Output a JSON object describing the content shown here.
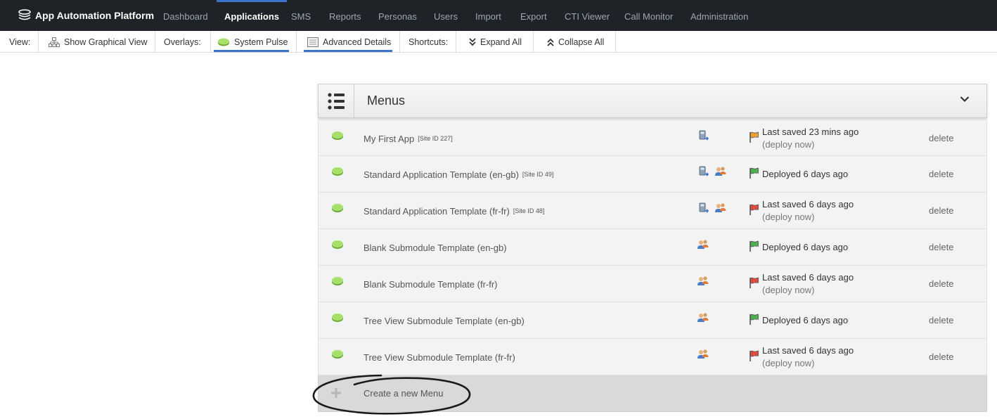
{
  "brand": {
    "name": "App Automation Platform"
  },
  "nav": [
    {
      "label": "Dashboard",
      "active": false
    },
    {
      "label": "Applications",
      "active": true
    },
    {
      "label": "SMS",
      "active": false
    },
    {
      "label": "Reports",
      "active": false
    },
    {
      "label": "Personas",
      "active": false
    },
    {
      "label": "Users",
      "active": false
    },
    {
      "label": "Import",
      "active": false
    },
    {
      "label": "Export",
      "active": false
    },
    {
      "label": "CTI Viewer",
      "active": false
    },
    {
      "label": "Call Monitor",
      "active": false
    },
    {
      "label": "Administration",
      "active": false
    }
  ],
  "toolbar": {
    "view_label": "View:",
    "graphical_view": "Show Graphical View",
    "overlays_label": "Overlays:",
    "system_pulse": "System Pulse",
    "advanced_details": "Advanced Details",
    "shortcuts_label": "Shortcuts:",
    "expand_all": "Expand All",
    "collapse_all": "Collapse All"
  },
  "panel": {
    "title": "Menus",
    "rows": [
      {
        "name": "My First App",
        "site": "[Site ID 227]",
        "icons": [
          "phone-forward-icon"
        ],
        "flag": "orange",
        "status": "Last saved 23 mins ago",
        "deploy": "(deploy now)",
        "delete": "delete"
      },
      {
        "name": "Standard Application Template (en-gb)",
        "site": "[Site ID 49]",
        "icons": [
          "phone-forward-icon",
          "users-icon"
        ],
        "flag": "green",
        "status": "Deployed 6 days ago",
        "deploy": "",
        "delete": "delete"
      },
      {
        "name": "Standard Application Template (fr-fr)",
        "site": "[Site ID 48]",
        "icons": [
          "phone-forward-icon",
          "users-icon"
        ],
        "flag": "red",
        "status": "Last saved 6 days ago",
        "deploy": "(deploy now)",
        "delete": "delete"
      },
      {
        "name": "Blank Submodule Template (en-gb)",
        "site": "",
        "icons": [
          "users-icon"
        ],
        "flag": "green",
        "status": "Deployed 6 days ago",
        "deploy": "",
        "delete": "delete"
      },
      {
        "name": "Blank Submodule Template (fr-fr)",
        "site": "",
        "icons": [
          "users-icon"
        ],
        "flag": "red",
        "status": "Last saved 6 days ago",
        "deploy": "(deploy now)",
        "delete": "delete"
      },
      {
        "name": "Tree View Submodule Template (en-gb)",
        "site": "",
        "icons": [
          "users-icon"
        ],
        "flag": "green",
        "status": "Deployed 6 days ago",
        "deploy": "",
        "delete": "delete"
      },
      {
        "name": "Tree View Submodule Template (fr-fr)",
        "site": "",
        "icons": [
          "users-icon"
        ],
        "flag": "red",
        "status": "Last saved 6 days ago",
        "deploy": "(deploy now)",
        "delete": "delete"
      }
    ],
    "create_label": "Create a new Menu"
  },
  "colors": {
    "nav_bg": "#1f2227",
    "accent": "#3a73c9",
    "flag_green": "#4caf50",
    "flag_red": "#e04b3a",
    "flag_orange": "#f0a030",
    "pill_green": "#8fd14f"
  }
}
